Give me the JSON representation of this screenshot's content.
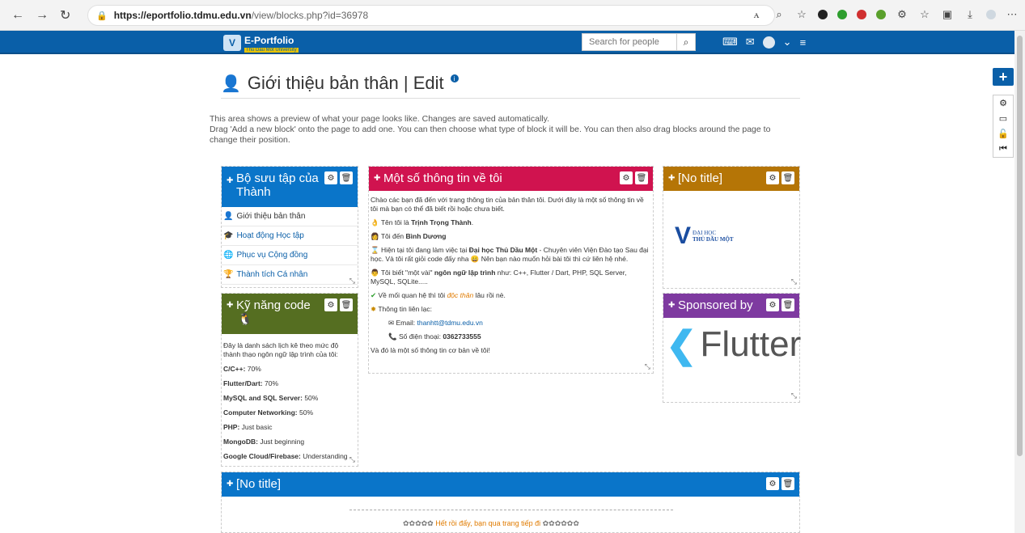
{
  "browser": {
    "url_host": "https://eportfolio.tdmu.edu.vn",
    "url_path": "/view/blocks.php?id=36978"
  },
  "header": {
    "logo_name": "E-Portfolio",
    "logo_sub": "Thu Dau Mot University",
    "search_placeholder": "Search for people"
  },
  "page": {
    "title": "Giới thiệu bản thân | Edit",
    "intro_1": "This area shows a preview of what your page looks like. Changes are saved automatically.",
    "intro_2": "Drag 'Add a new block' onto the page to add one. You can then choose what type of block it will be. You can then also drag blocks around the page to change their position."
  },
  "blocks": {
    "collection": {
      "title": "Bộ sưu tập của Thành",
      "items": [
        "Giới thiệu bản thân",
        "Hoạt động Học tập",
        "Phục vụ Cộng đồng",
        "Thành tích Cá nhân"
      ]
    },
    "info": {
      "title": "Một số thông tin về tôi",
      "p1": "Chào các bạn đã đến với trang thông tin của bản thân tôi. Dưới đây là một số thông tin về tôi mà bạn có thể đã biết rồi hoặc chưa biết.",
      "name_pre": "Tên tôi là ",
      "name": "Trịnh Trọng Thành",
      "from_pre": "Tôi đến ",
      "from": "Bình Dương",
      "work_pre": "Hiện tại tôi đang làm việc tại ",
      "work_org": "Đại học Thủ Dầu Một",
      "work_post": " - Chuyên viên Viện Đào tạo Sau đại học. Và tôi rất giỏi code đấy nha 😄 Nên bạn nào muốn hỏi bài tôi thì cứ liên hệ nhé.",
      "lang_pre": "Tôi biết \"một vài\" ",
      "lang_b": "ngôn ngữ lập trình",
      "lang_post": " như: C++, Flutter / Dart, PHP, SQL Server, MySQL, SQLite.....",
      "rel_pre": "Về mối quan hệ thì tôi ",
      "rel_em": "độc thân",
      "rel_post": " lâu rồi nè.",
      "contact": "Thông tin liên lạc:",
      "email_label": "Email: ",
      "email": "thanhtt@tdmu.edu.vn",
      "phone_label": "Số điện thoại: ",
      "phone": "0362733555",
      "end": "Và đó là một số thông tin cơ bản về tôi!"
    },
    "notitle1": {
      "title": "[No title]",
      "logo_text_1": "ĐẠI HỌC",
      "logo_text_2": "THỦ DẦU MỘT"
    },
    "skills": {
      "title": "Kỹ năng code",
      "desc": "Đây là danh sách lịch kê theo mức độ thành thạo ngôn ngữ lập trình của tôi:",
      "items": [
        {
          "name": "C/C++:",
          "val": " 70%"
        },
        {
          "name": "Flutter/Dart:",
          "val": " 70%"
        },
        {
          "name": "MySQL and SQL Server:",
          "val": " 50%"
        },
        {
          "name": "Computer Networking:",
          "val": " 50%"
        },
        {
          "name": "PHP:",
          "val": " Just basic"
        },
        {
          "name": "MongoDB:",
          "val": " Just beginning"
        },
        {
          "name": "Google Cloud/Firebase:",
          "val": " Understanding"
        }
      ]
    },
    "sponsor": {
      "title": "Sponsored by",
      "brand": "Flutter"
    },
    "notitle2": {
      "title": "[No title]",
      "text": "Hết rồi đấy, bạn qua trang tiếp đi"
    }
  }
}
